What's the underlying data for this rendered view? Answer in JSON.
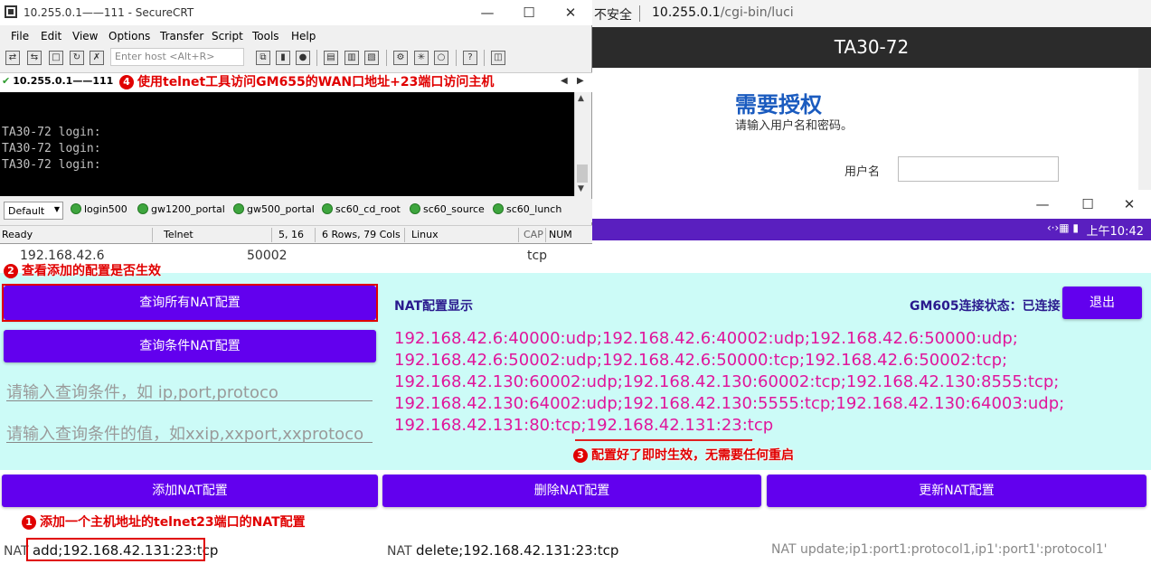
{
  "browser": {
    "insecure_label": "不安全",
    "url_host": "10.255.0.1",
    "url_path": "/cgi-bin/luci",
    "header_title": "TA30-72",
    "auth_title": "需要授权",
    "auth_subtitle": "请输入用户名和密码。",
    "username_label": "用户名",
    "username_value": ""
  },
  "securecrt": {
    "window_title": "10.255.0.1——111 - SecureCRT",
    "menu": [
      "File",
      "Edit",
      "View",
      "Options",
      "Transfer",
      "Script",
      "Tools",
      "Help"
    ],
    "host_placeholder": "Enter host <Alt+R>",
    "tab_label": "10.255.0.1——111",
    "terminal_lines": [
      "TA30-72 login:",
      "TA30-72 login:",
      "TA30-72 login:"
    ],
    "session_default": "Default",
    "sessions": [
      "login500",
      "gw1200_portal",
      "gw500_portal",
      "sc60_cd_root",
      "sc60_source",
      "sc60_lunch"
    ],
    "status": {
      "ready": "Ready",
      "protocol": "Telnet",
      "cursor": "5, 16",
      "size": "6 Rows, 79 Cols",
      "os": "Linux",
      "cap": "CAP",
      "num": "NUM"
    }
  },
  "app": {
    "status_time": "上午10:42",
    "partial_row": {
      "ip": "192.168.42.6",
      "port": "50002",
      "protocol": "tcp"
    },
    "query_all_button": "查询所有NAT配置",
    "query_cond_button": "查询条件NAT配置",
    "cond_field_placeholder": "请输入查询条件，如 ip,port,protoco",
    "cond_value_placeholder": "请输入查询条件的值，如xxip,xxport,xxprotoco",
    "nat_display_title": "NAT配置显示",
    "connection_status": "GM605连接状态：已连接",
    "logout_button": "退出",
    "nat_entries": [
      "192.168.42.6:40000:udp;192.168.42.6:40002:udp;192.168.42.6:50000:udp;",
      "192.168.42.6:50002:udp;192.168.42.6:50000:tcp;192.168.42.6:50002:tcp;",
      "192.168.42.130:60002:udp;192.168.42.130:60002:tcp;192.168.42.130:8555:tcp;",
      "192.168.42.130:64002:udp;192.168.42.130:5555:tcp;192.168.42.130:64003:udp;"
    ],
    "nat_last_line_a": "192.168.42.131:80:tcp;",
    "nat_last_line_b": "192.168.42.131:23:tcp",
    "add_button": "添加NAT配置",
    "delete_button": "删除NAT配置",
    "update_button": "更新NAT配置",
    "add_prefix": "NAT",
    "add_value": "add;192.168.42.131:23:tcp",
    "delete_prefix": "NAT",
    "delete_value": "delete;192.168.42.131:23:tcp",
    "update_prefix": "NAT",
    "update_placeholder": "update;ip1:port1:protocol1,ip1':port1':protocol1'"
  },
  "annotations": {
    "a1_num": "1",
    "a1": "添加一个主机地址的telnet23端口的NAT配置",
    "a2_num": "2",
    "a2": "查看添加的配置是否生效",
    "a3_num": "3",
    "a3": "配置好了即时生效，无需要任何重启",
    "a4_num": "4",
    "a4": "使用telnet工具访问GM655的WAN口地址+23端口访问主机"
  },
  "colors": {
    "accent_purple": "#6200ee",
    "panel_cyan": "#ccfbf7",
    "nat_text": "#e0169b",
    "annotation_red": "#e00000"
  }
}
